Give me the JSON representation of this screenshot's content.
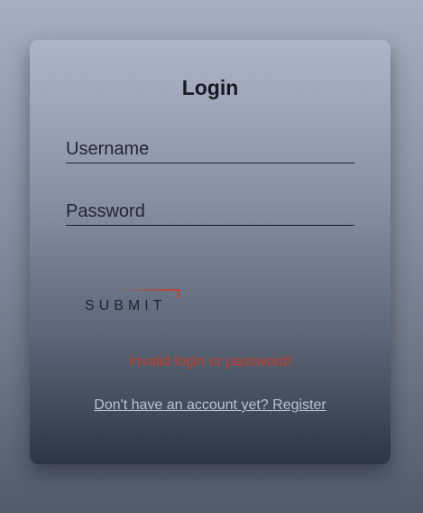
{
  "login": {
    "title": "Login",
    "username_placeholder": "Username",
    "password_placeholder": "Password",
    "submit_label": "SUBMIT",
    "error_message": "Invalid login or password!",
    "register_link": "Don't have an account yet? Register"
  },
  "colors": {
    "error": "#c63d2c",
    "accent_line": "#c43f2e",
    "link": "#b9c2d0"
  }
}
